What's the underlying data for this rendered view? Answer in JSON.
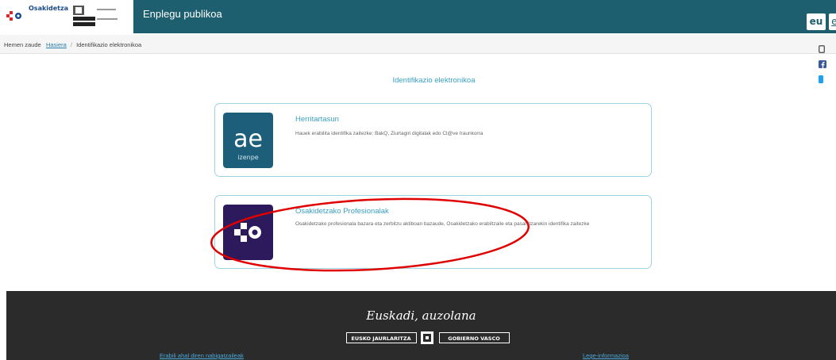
{
  "header": {
    "brand": "Osakidetza",
    "title": "Enplegu publikoa",
    "lang_active": "eu",
    "lang_other": "es"
  },
  "breadcrumb": {
    "prefix": "Hemen zaude",
    "home": "Hasiera",
    "separator": "/",
    "current": "Identifikazio elektronikoa"
  },
  "main": {
    "section_title": "Identifikazio elektronikoa",
    "cards": [
      {
        "title": "Herritartasun",
        "description": "Hauek erabilita identifika zaitezke: BakQ, Ziurtagiri digitalak edo Cl@ve Iraunkorra",
        "icon_text": "ae",
        "icon_sub": "izenpe",
        "icon_color": "#1d5f7a"
      },
      {
        "title": "Osakidetzako Profesionalak",
        "description": "Osakidetzako profesionala bazara eta zerbitzu aktiboan bazaude, Osakidetzako erabiltzaile eta pasahitzarekin identifika zaitezke",
        "icon_color": "#2d1a5c"
      }
    ]
  },
  "footer": {
    "slogan": "Euskadi, auzolana",
    "gov_left": "EUSKO JAURLARITZA",
    "gov_right": "GOBIERNO VASCO",
    "link_browsers": "Erabili ahal diren nabigatzaileak",
    "link_legal": "Lege-informazioa"
  },
  "colors": {
    "header_bg": "#1d5f6f",
    "accent": "#39a0c2",
    "annotation": "#e00000"
  }
}
